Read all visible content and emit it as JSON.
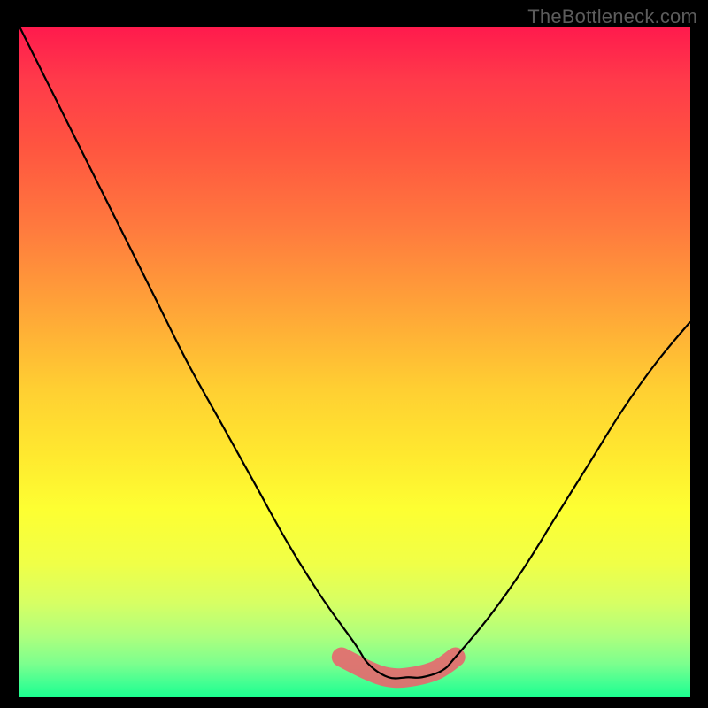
{
  "watermark": "TheBottleneck.com",
  "colors": {
    "background": "#000000",
    "curve": "#000000",
    "highlight": "#e56a6f",
    "gradient_top": "#ff1a4d",
    "gradient_bottom": "#1aff8f"
  },
  "chart_data": {
    "type": "line",
    "title": "",
    "xlabel": "",
    "ylabel": "",
    "xlim": [
      0,
      100
    ],
    "ylim": [
      0,
      100
    ],
    "grid": false,
    "legend": false,
    "description": "V-shaped bottleneck curve on rainbow vertical gradient; lower values (closer to 0) are better / greener. Minimum (optimal) region near x ≈ 52–65 at y ≈ 3. Left branch descends steeper and more linearly than the right branch which rises more gently. Authors annotate the near-minimum band with a thick pink stroke.",
    "series": [
      {
        "name": "bottleneck_curve",
        "x": [
          0,
          5,
          10,
          15,
          20,
          25,
          30,
          35,
          40,
          45,
          50,
          52,
          55,
          58,
          60,
          63,
          65,
          70,
          75,
          80,
          85,
          90,
          95,
          100
        ],
        "y": [
          100,
          90,
          80,
          70,
          60,
          50,
          41,
          32,
          23,
          15,
          8,
          5,
          3,
          3,
          3,
          4,
          6,
          12,
          19,
          27,
          35,
          43,
          50,
          56
        ]
      }
    ],
    "highlight_region": {
      "name": "optimal_band",
      "x": [
        48,
        52,
        55,
        58,
        62,
        65
      ],
      "y": [
        6,
        4,
        3,
        3,
        4,
        6
      ]
    }
  }
}
